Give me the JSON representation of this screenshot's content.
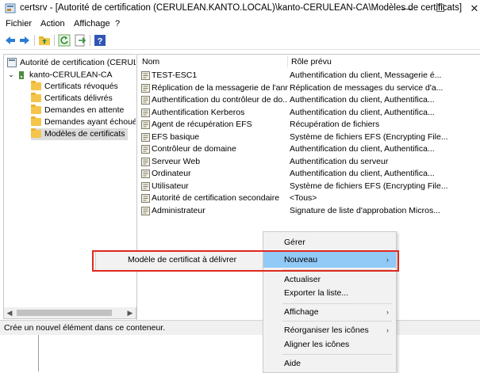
{
  "window": {
    "title": "certsrv - [Autorité de certification (CERULEAN.KANTO.LOCAL)\\kanto-CERULEAN-CA\\Modèles de certificats]",
    "minimize": "—",
    "maximize": "☐",
    "close": "✕"
  },
  "menu": {
    "file": "Fichier",
    "action": "Action",
    "view": "Affichage",
    "help": "?"
  },
  "toolbar": {
    "icons": [
      "back-icon",
      "forward-icon",
      "up-folder-icon",
      "refresh-icon",
      "export-list-icon",
      "help-icon"
    ]
  },
  "tree": {
    "root": "Autorité de certification (CERULEA",
    "ca": "kanto-CERULEAN-CA",
    "items": [
      "Certificats révoqués",
      "Certificats délivrés",
      "Demandes en attente",
      "Demandes ayant échoué",
      "Modèles de certificats"
    ],
    "selected_index": 4
  },
  "list": {
    "col_name": "Nom",
    "col_role": "Rôle prévu",
    "rows": [
      {
        "name": "TEST-ESC1",
        "role": "Authentification du client, Messagerie é..."
      },
      {
        "name": "Réplication de la messagerie de l'ann...",
        "role": "Réplication de messages du service d'a..."
      },
      {
        "name": "Authentification du contrôleur de do...",
        "role": "Authentification du client, Authentifica..."
      },
      {
        "name": "Authentification Kerberos",
        "role": "Authentification du client, Authentifica..."
      },
      {
        "name": "Agent de récupération EFS",
        "role": "Récupération de fichiers"
      },
      {
        "name": "EFS basique",
        "role": "Système de fichiers EFS (Encrypting File..."
      },
      {
        "name": "Contrôleur de domaine",
        "role": "Authentification du client, Authentifica..."
      },
      {
        "name": "Serveur Web",
        "role": "Authentification du serveur"
      },
      {
        "name": "Ordinateur",
        "role": "Authentification du client, Authentifica..."
      },
      {
        "name": "Utilisateur",
        "role": "Système de fichiers EFS (Encrypting File..."
      },
      {
        "name": "Autorité de certification secondaire",
        "role": "<Tous>"
      },
      {
        "name": "Administrateur",
        "role": "Signature de liste d'approbation Micros..."
      }
    ]
  },
  "status": {
    "text": "Crée un nouvel élément dans ce conteneur."
  },
  "context_menu": {
    "items": [
      {
        "label": "Gérer",
        "arrow": ""
      },
      {
        "label": "Nouveau",
        "arrow": "›",
        "highlighted": true
      },
      {
        "label": "Actualiser",
        "arrow": ""
      },
      {
        "label": "Exporter la liste...",
        "arrow": ""
      },
      {
        "label": "Affichage",
        "arrow": "›"
      },
      {
        "label": "Réorganiser les icônes",
        "arrow": "›"
      },
      {
        "label": "Aligner les icônes",
        "arrow": ""
      },
      {
        "label": "Aide",
        "arrow": ""
      }
    ]
  },
  "submenu": {
    "item": "Modèle de certificat à délivrer"
  },
  "colors": {
    "highlight": "#91c9f7",
    "annotation_box": "#e0281e",
    "menu_bg": "#f2f2f2"
  }
}
